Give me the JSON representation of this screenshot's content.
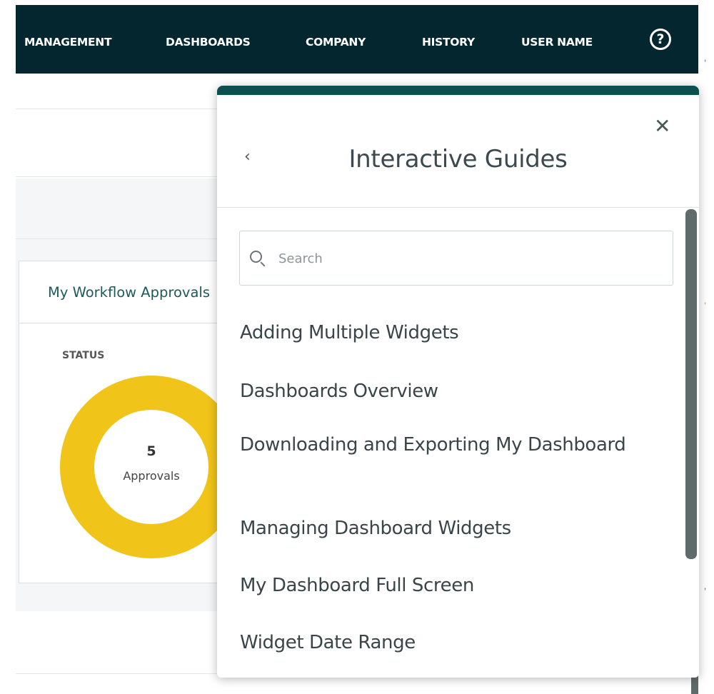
{
  "nav": {
    "items": [
      "MANAGEMENT",
      "DASHBOARDS",
      "COMPANY",
      "HISTORY",
      "USER NAME"
    ],
    "help_symbol": "?"
  },
  "background": {
    "card_title": "My Workflow Approvals",
    "status_label": "STATUS",
    "donut": {
      "count": "5",
      "label": "Approvals",
      "color": "#f0c419"
    }
  },
  "panel": {
    "back_symbol": "‹",
    "title": "Interactive Guides",
    "close_symbol": "✕",
    "search_placeholder": "Search",
    "guides": [
      "Adding Multiple Widgets",
      "Dashboards Overview",
      "Downloading and Exporting My Dashboard",
      "Managing Dashboard Widgets",
      "My Dashboard Full Screen",
      "Widget Date Range"
    ]
  },
  "colors": {
    "nav_bg": "#03262f",
    "panel_accent": "#0d4f4f",
    "card_title": "#1c5b5a"
  }
}
